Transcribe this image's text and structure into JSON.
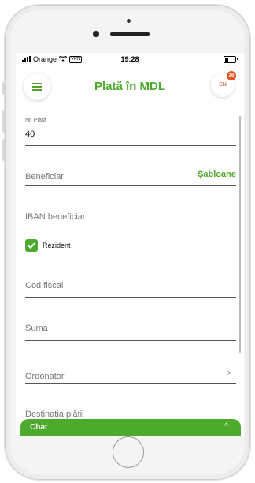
{
  "status_bar": {
    "carrier": "Orange",
    "vpn": "VPN",
    "time": "19:28"
  },
  "header": {
    "title": "Plată în MDL",
    "avatar_initials": "SN",
    "notification_count": "26"
  },
  "form": {
    "nr_plata": {
      "label": "Nr. Plată",
      "value": "40"
    },
    "beneficiar": {
      "placeholder": "Beneficiar",
      "action": "Şabloane"
    },
    "iban": {
      "placeholder": "IBAN beneficiar"
    },
    "rezident": {
      "label": "Rezident",
      "checked": true
    },
    "cod_fiscal": {
      "placeholder": "Cod fiscal"
    },
    "suma": {
      "placeholder": "Suma"
    },
    "ordonator": {
      "placeholder": "Ordonator",
      "chevron": ">"
    },
    "destinatia": {
      "placeholder": "Destinatia plății"
    }
  },
  "chat": {
    "label": "Chat",
    "arrow": "^"
  },
  "colors": {
    "accent": "#4caa2c",
    "badge": "#e8521f"
  }
}
